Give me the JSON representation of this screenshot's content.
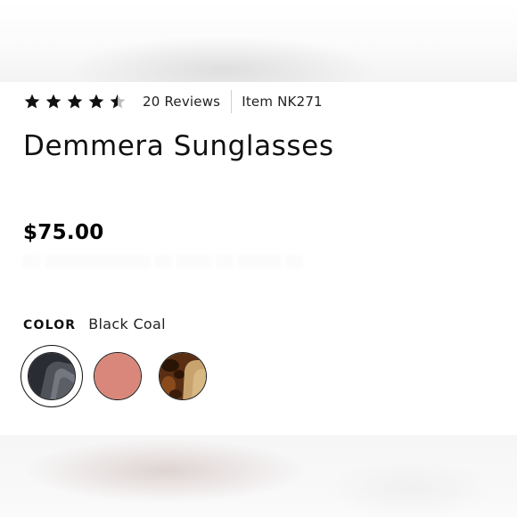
{
  "product": {
    "rating": 4.5,
    "rating_max": 5,
    "reviews_label": "20 Reviews",
    "item_label": "Item NK271",
    "title": "Demmera Sunglasses",
    "price": "$75.00"
  },
  "color": {
    "label": "COLOR",
    "selected_value": "Black Coal",
    "swatches": [
      {
        "name": "Black Coal",
        "selected": true
      },
      {
        "name": "Rose",
        "selected": false
      },
      {
        "name": "Tortoise",
        "selected": false
      }
    ]
  },
  "icons": {
    "star": "star-icon",
    "half_star": "half-star-icon"
  },
  "colors": {
    "text": "#111111",
    "star": "#111111",
    "star_empty": "#bdbdbd",
    "swatch_black": "#2a2c33",
    "swatch_rose": "#d9877a",
    "swatch_tortoise": "#5a2e12",
    "swatch_tortoise_lens": "#c9a36d"
  }
}
